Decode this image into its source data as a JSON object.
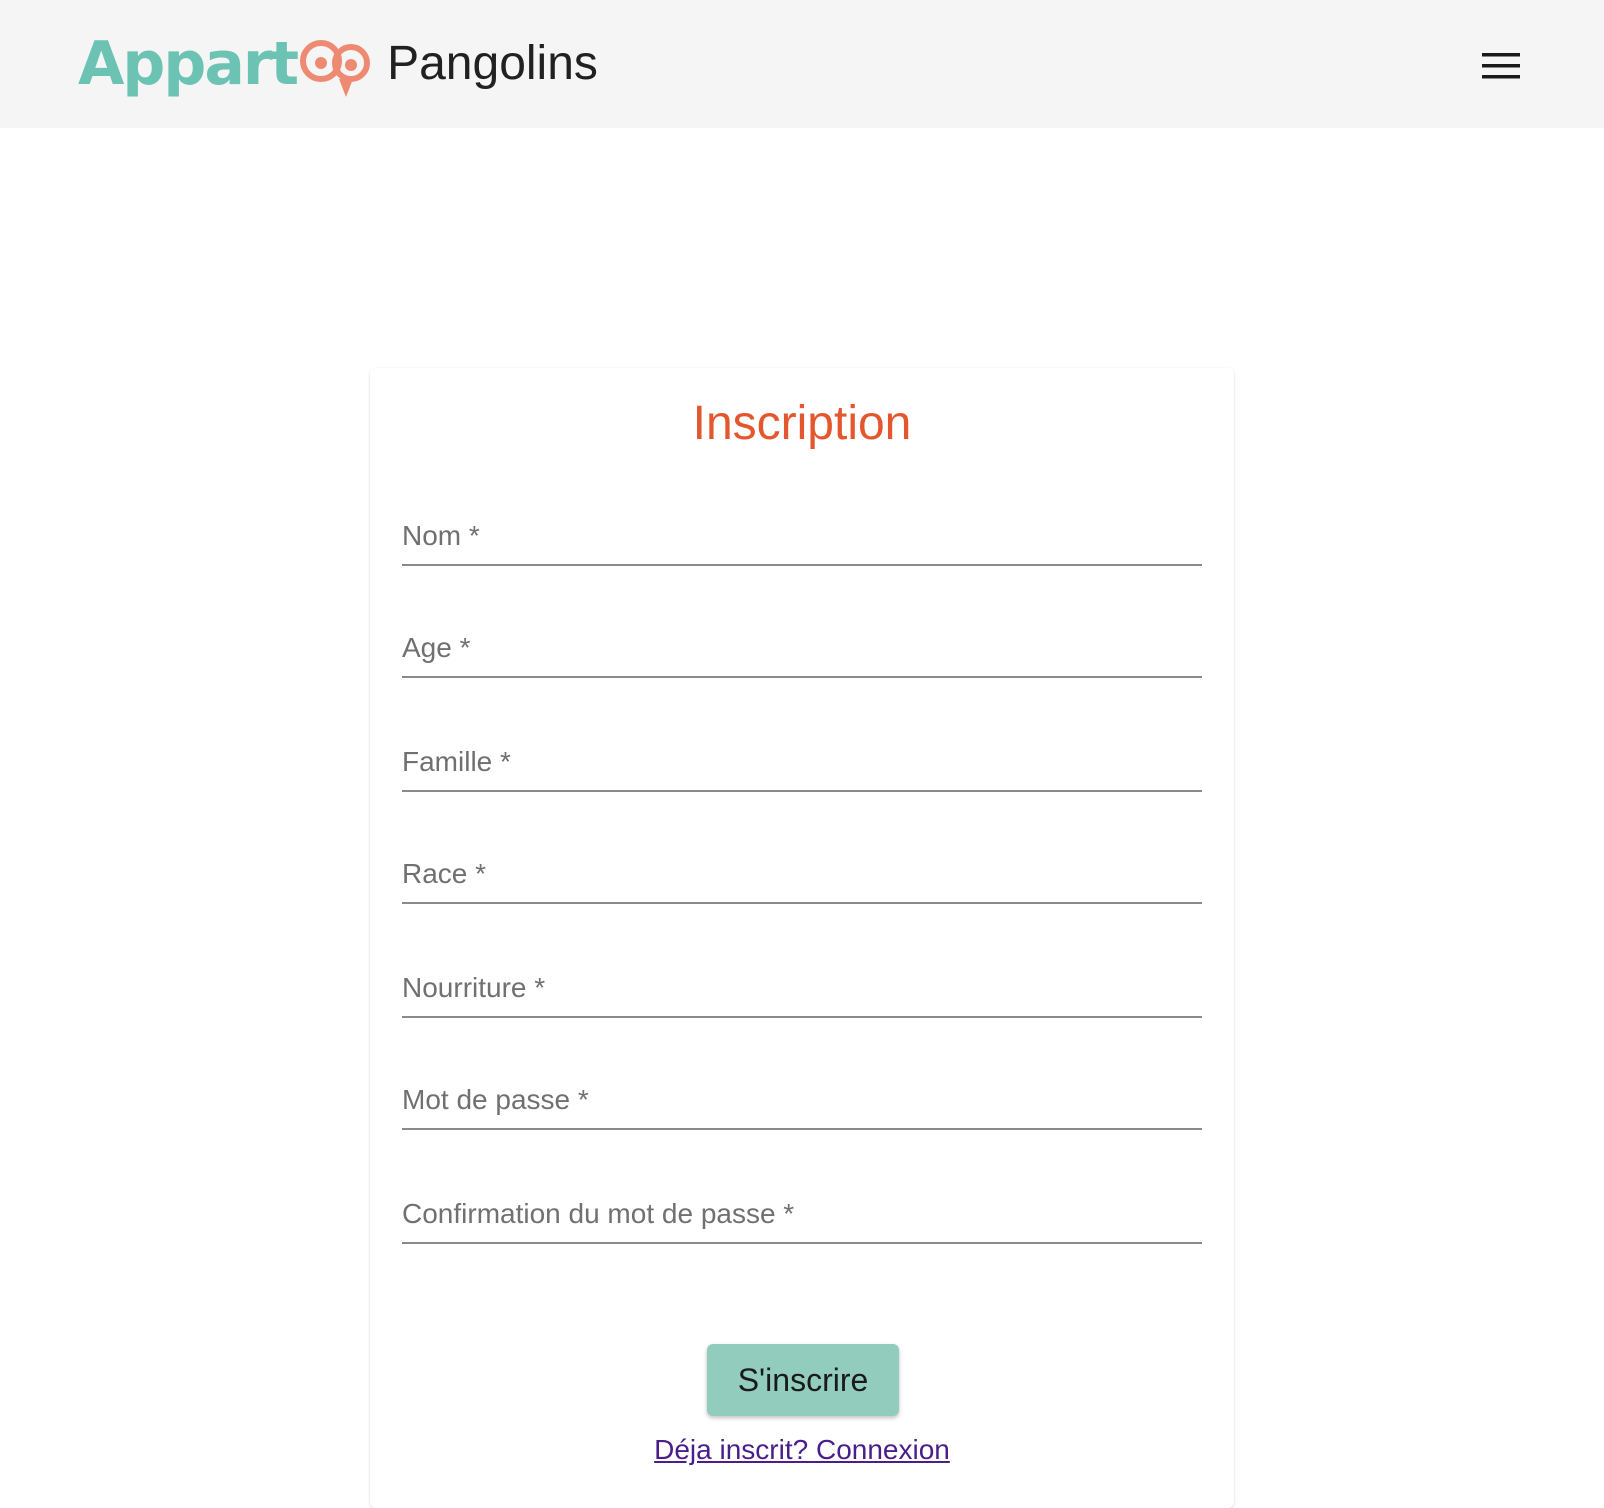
{
  "header": {
    "logo_text": "Appart",
    "app_title": "Pangolins",
    "menu_icon": "hamburger-menu-icon"
  },
  "form": {
    "title": "Inscription",
    "fields": [
      {
        "label": "Nom *",
        "value": ""
      },
      {
        "label": "Age *",
        "value": ""
      },
      {
        "label": "Famille *",
        "value": ""
      },
      {
        "label": "Race *",
        "value": ""
      },
      {
        "label": "Nourriture *",
        "value": ""
      },
      {
        "label": "Mot de passe *",
        "value": ""
      },
      {
        "label": "Confirmation du mot de passe *",
        "value": ""
      }
    ],
    "submit_label": "S'inscrire",
    "login_link_label": "Déja inscrit? Connexion"
  },
  "colors": {
    "header_bg": "#f5f5f5",
    "logo_teal": "#6cc3b3",
    "logo_coral": "#ee8a72",
    "title_color": "#e4572e",
    "button_bg": "#92ccbc",
    "link_color": "#4a1d8c"
  }
}
